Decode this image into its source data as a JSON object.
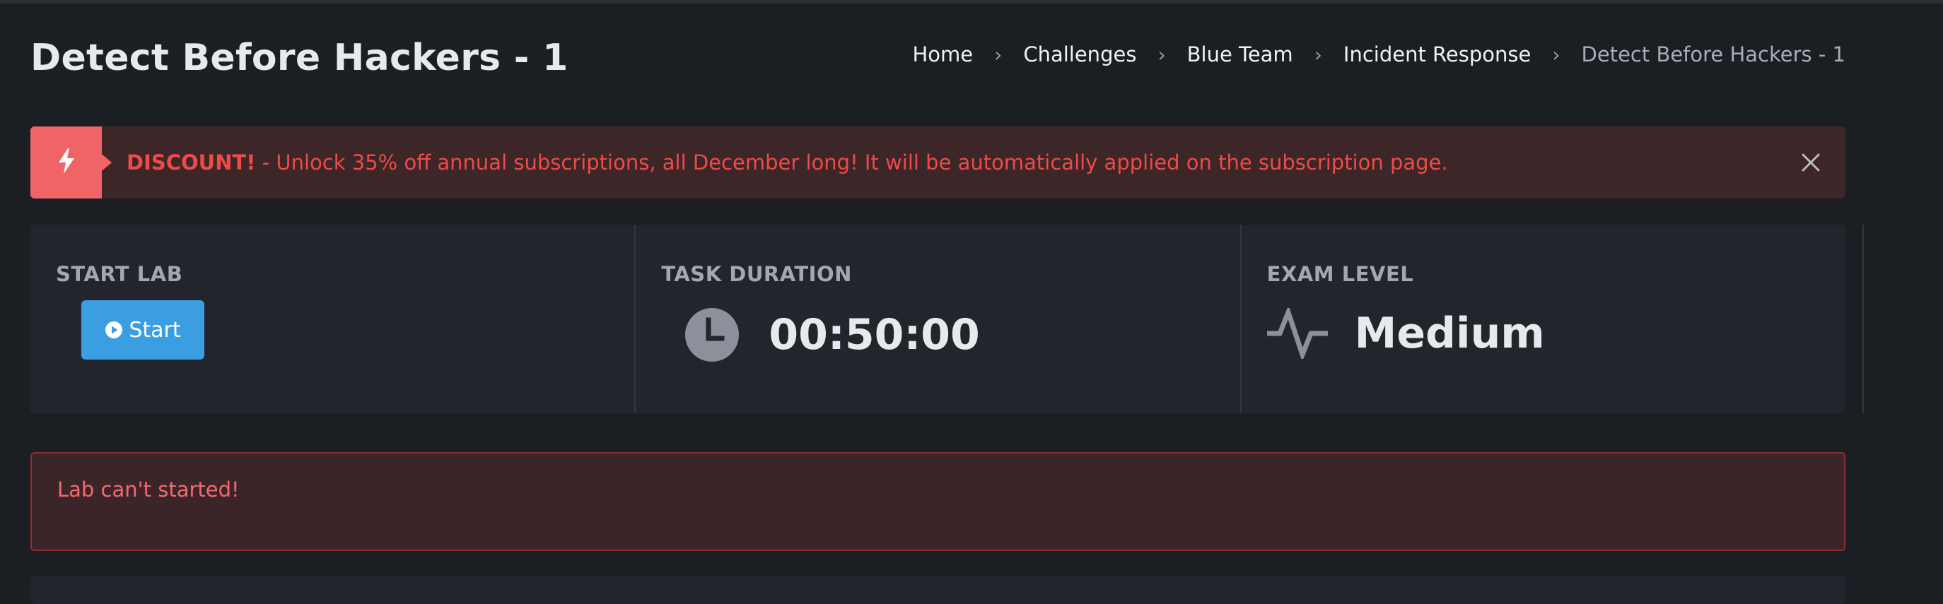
{
  "page": {
    "title": "Detect Before Hackers - 1"
  },
  "breadcrumb": [
    {
      "label": "Home"
    },
    {
      "label": "Challenges"
    },
    {
      "label": "Blue Team"
    },
    {
      "label": "Incident Response"
    },
    {
      "label": "Detect Before Hackers - 1"
    }
  ],
  "discount": {
    "icon": "bolt-icon",
    "strong": "DISCOUNT!",
    "message": " - Unlock 35% off annual subscriptions, all December long! It will be automatically applied on the subscription page.",
    "close_icon": "close-icon",
    "accent_color": "#f06366",
    "text_color": "#ee4b47"
  },
  "stats": {
    "start_lab": {
      "label": "START LAB",
      "button_label": "Start",
      "button_icon": "play-circle-icon",
      "button_color": "#3a9ee0"
    },
    "task_duration": {
      "label": "TASK DURATION",
      "value": "00:50:00",
      "icon": "clock-icon"
    },
    "exam_level": {
      "label": "EXAM LEVEL",
      "value": "Medium",
      "icon": "activity-icon"
    }
  },
  "alert": {
    "message": "Lab can't started!",
    "color": "#f26a6e"
  }
}
